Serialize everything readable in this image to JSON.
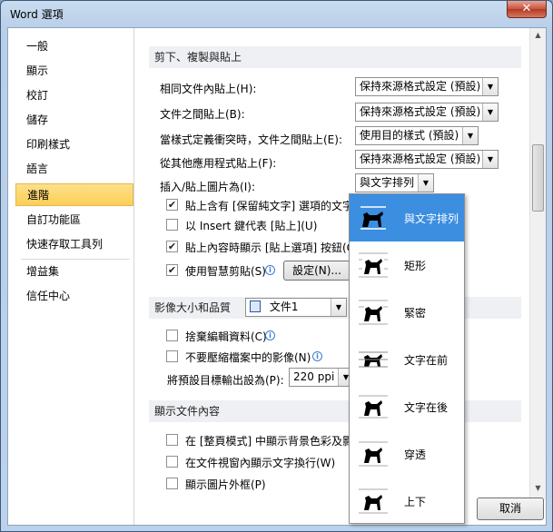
{
  "window": {
    "title": "Word 選項",
    "close_glyph": "✕"
  },
  "sidebar": {
    "items": [
      {
        "label": "一般"
      },
      {
        "label": "顯示"
      },
      {
        "label": "校訂"
      },
      {
        "label": "儲存"
      },
      {
        "label": "印刷樣式"
      },
      {
        "label": "語言"
      },
      {
        "label": "進階"
      },
      {
        "label": "自訂功能區"
      },
      {
        "label": "快速存取工具列"
      },
      {
        "label": "增益集"
      },
      {
        "label": "信任中心"
      }
    ],
    "selected": "進階"
  },
  "section_paste": {
    "title": "剪下、複製與貼上",
    "rows": [
      {
        "label": "相同文件內貼上(H):",
        "value": "保持來源格式設定 (預設)"
      },
      {
        "label": "文件之間貼上(B):",
        "value": "保持來源格式設定 (預設)"
      },
      {
        "label": "當樣式定義衝突時，文件之間貼上(E):",
        "value": "使用目的樣式 (預設)"
      },
      {
        "label": "從其他應用程式貼上(F):",
        "value": "保持來源格式設定 (預設)"
      },
      {
        "label": "插入/貼上圖片為(I):",
        "value": "與文字排列"
      }
    ],
    "checks": [
      {
        "label": "貼上含有 [保留純文字] 選項的文字時",
        "checked": true
      },
      {
        "label": "以 Insert 鍵代表 [貼上](U)",
        "checked": false
      },
      {
        "label": "貼上內容時顯示 [貼上選項] 按鈕(O)",
        "checked": true
      },
      {
        "label": "使用智慧剪貼(S)",
        "checked": true
      }
    ],
    "settings_button": "設定(N)..."
  },
  "section_image": {
    "title": "影像大小和品質",
    "doc_value": "文件1",
    "checks": [
      {
        "label": "捨棄編輯資料(C)",
        "checked": false
      },
      {
        "label": "不要壓縮檔案中的影像(N)",
        "checked": false
      }
    ],
    "resolution_label": "將預設目標輸出設為(P):",
    "resolution_value": "220 ppi"
  },
  "section_display": {
    "title": "顯示文件內容",
    "checks": [
      {
        "label": "在 [整頁模式] 中顯示背景色彩及影像",
        "checked": false
      },
      {
        "label": "在文件視窗內顯示文字換行(W)",
        "checked": false
      },
      {
        "label": "顯示圖片外框(P)",
        "checked": false
      }
    ]
  },
  "dropdown_options": [
    {
      "label": "與文字排列",
      "icon": "inline-with-text-icon"
    },
    {
      "label": "矩形",
      "icon": "square-wrap-icon"
    },
    {
      "label": "緊密",
      "icon": "tight-wrap-icon"
    },
    {
      "label": "文字在前",
      "icon": "in-front-of-text-icon"
    },
    {
      "label": "文字在後",
      "icon": "behind-text-icon"
    },
    {
      "label": "穿透",
      "icon": "through-wrap-icon"
    },
    {
      "label": "上下",
      "icon": "top-and-bottom-icon"
    }
  ],
  "dropdown_selected": "與文字排列",
  "footer": {
    "cancel_label": "取消"
  },
  "colors": {
    "selected_sidebar": "#fbcf57",
    "dropdown_highlight": "#3b8ee0"
  }
}
